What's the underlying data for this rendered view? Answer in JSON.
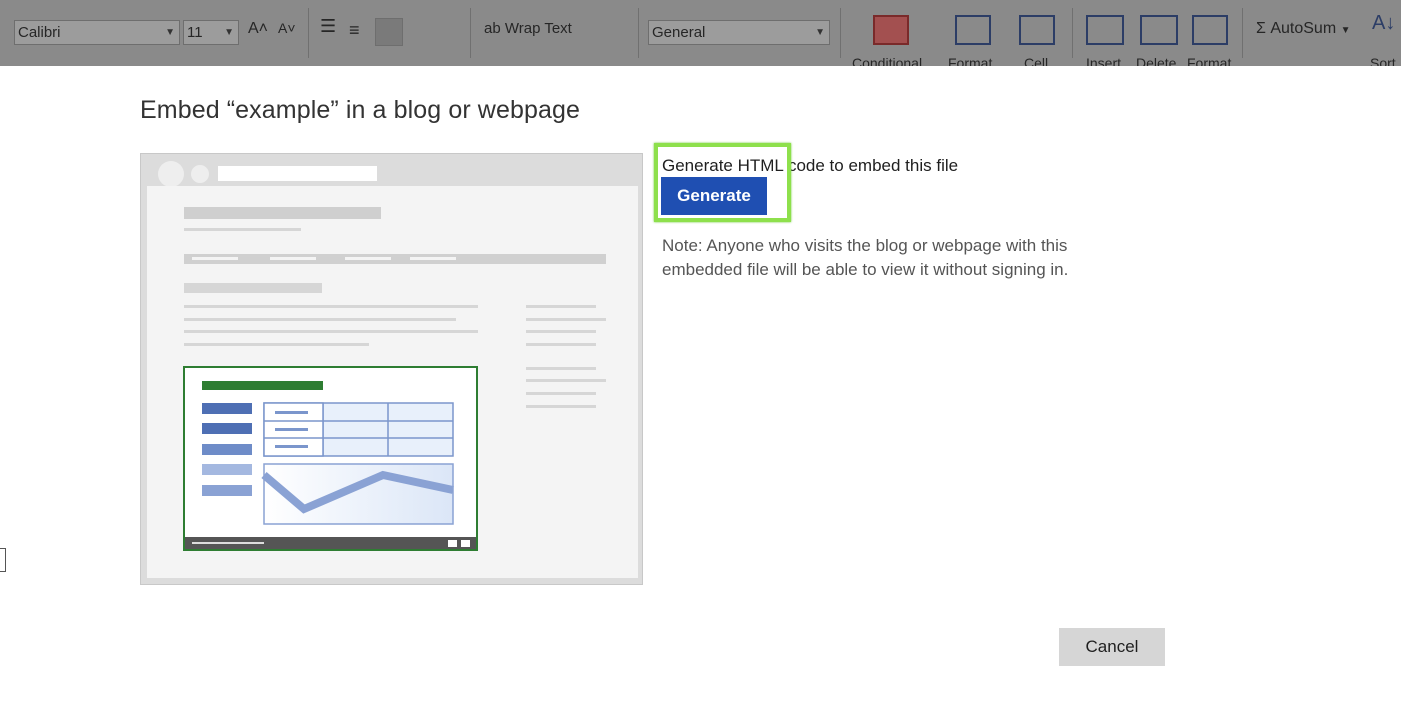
{
  "ribbon": {
    "font_name": "Calibri",
    "font_size": "11",
    "wrap_text": "Wrap Text",
    "number_format": "General",
    "conditional": "Conditional",
    "format_table": "Format",
    "cell_styles": "Cell",
    "insert": "Insert",
    "delete": "Delete",
    "format": "Format",
    "autosum": "AutoSum",
    "sort": "Sort"
  },
  "dialog": {
    "title": "Embed “example” in a blog or webpage",
    "embed_label": "Generate HTML code to embed this file",
    "generate_label": "Generate",
    "note": "Note: Anyone who visits the blog or webpage with this embedded file will be able to view it without signing in.",
    "cancel_label": "Cancel"
  },
  "colors": {
    "primary_button": "#1f4fb2",
    "highlight": "#8ee04c",
    "illustration_accent": "#2e7d32"
  }
}
